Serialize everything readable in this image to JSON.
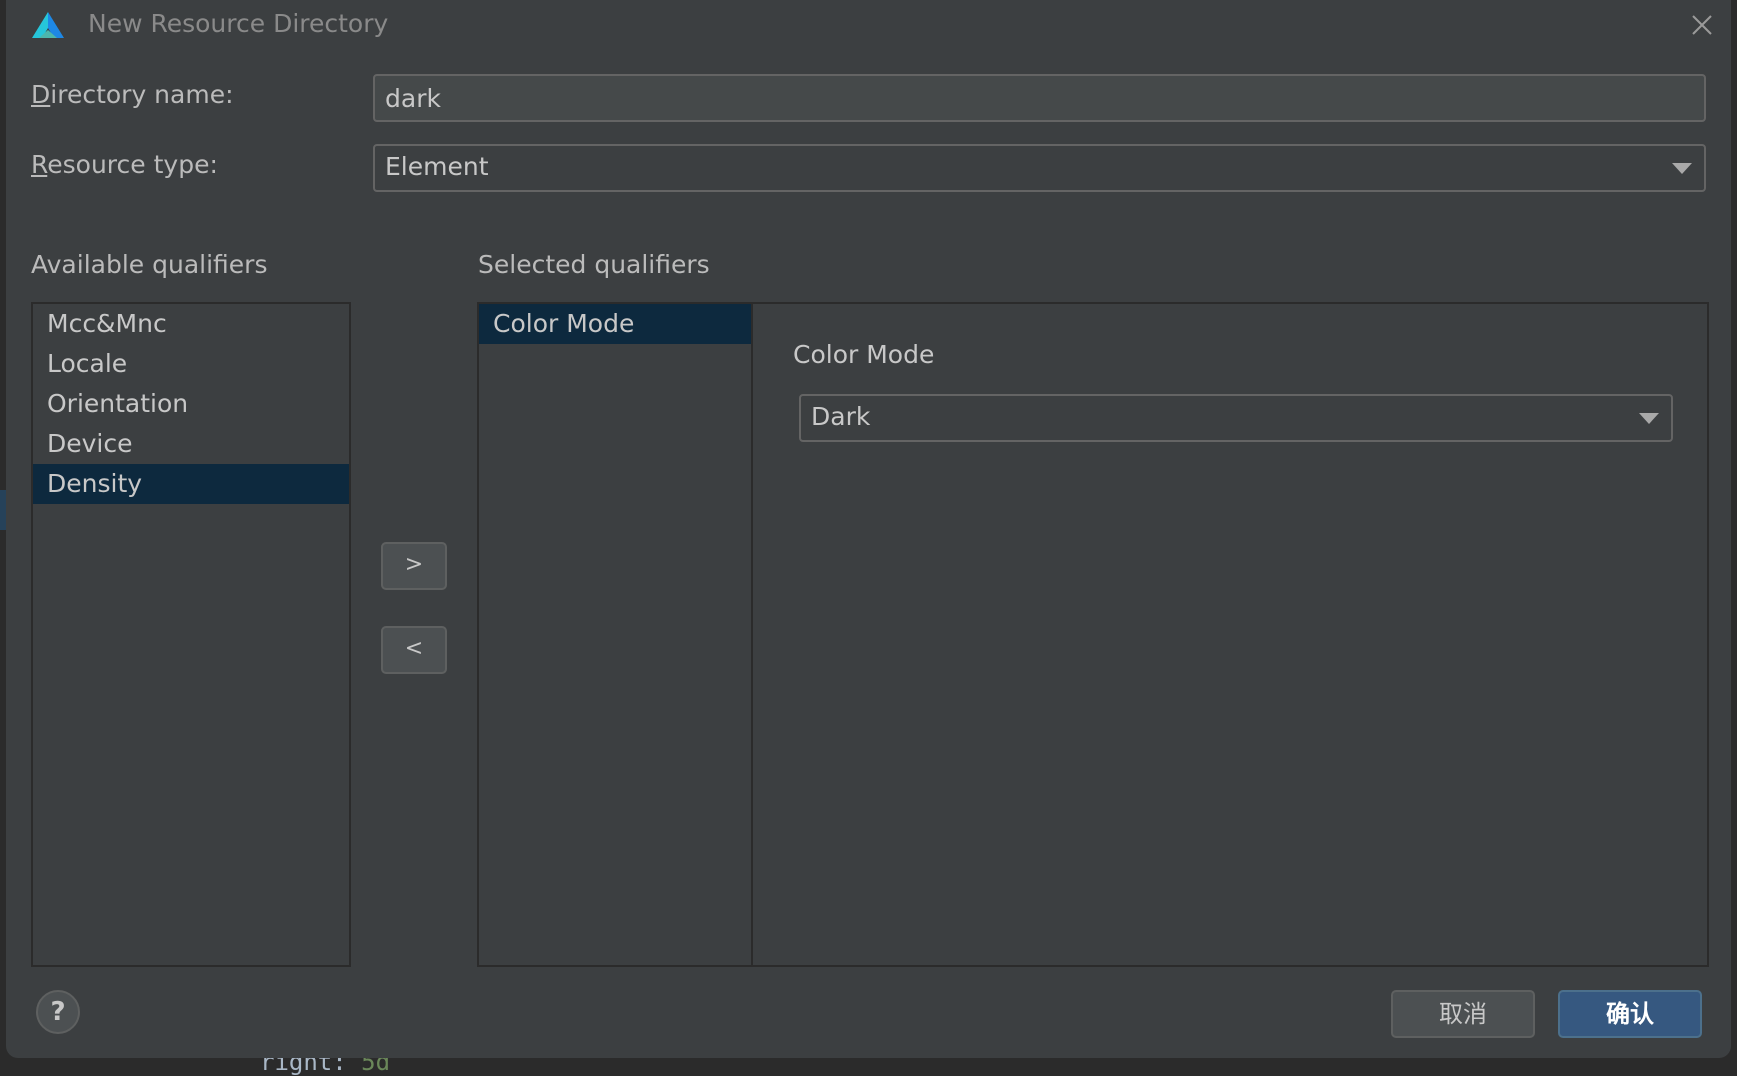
{
  "window": {
    "title": "New Resource Directory"
  },
  "form": {
    "directory_name_label_first": "D",
    "directory_name_label_rest": "irectory name:",
    "directory_name_value": "dark",
    "resource_type_label_first": "R",
    "resource_type_label_rest": "esource type:",
    "resource_type_value": "Element"
  },
  "available": {
    "label": "Available qualifiers",
    "items": [
      "Mcc&Mnc",
      "Locale",
      "Orientation",
      "Device",
      "Density"
    ],
    "selected": "Density"
  },
  "selected": {
    "label": "Selected qualifiers",
    "items": [
      "Color Mode"
    ],
    "selected": "Color Mode"
  },
  "detail": {
    "label": "Color Mode",
    "value": "Dark"
  },
  "buttons": {
    "add": ">",
    "remove": "<",
    "help": "?",
    "cancel": "取消",
    "ok": "确认"
  },
  "background_code": {
    "text": "right: ",
    "number": "5d"
  },
  "colors": {
    "dialog_bg": "#3c3f41",
    "selection_bg": "#0d293e",
    "primary_button": "#365880"
  }
}
